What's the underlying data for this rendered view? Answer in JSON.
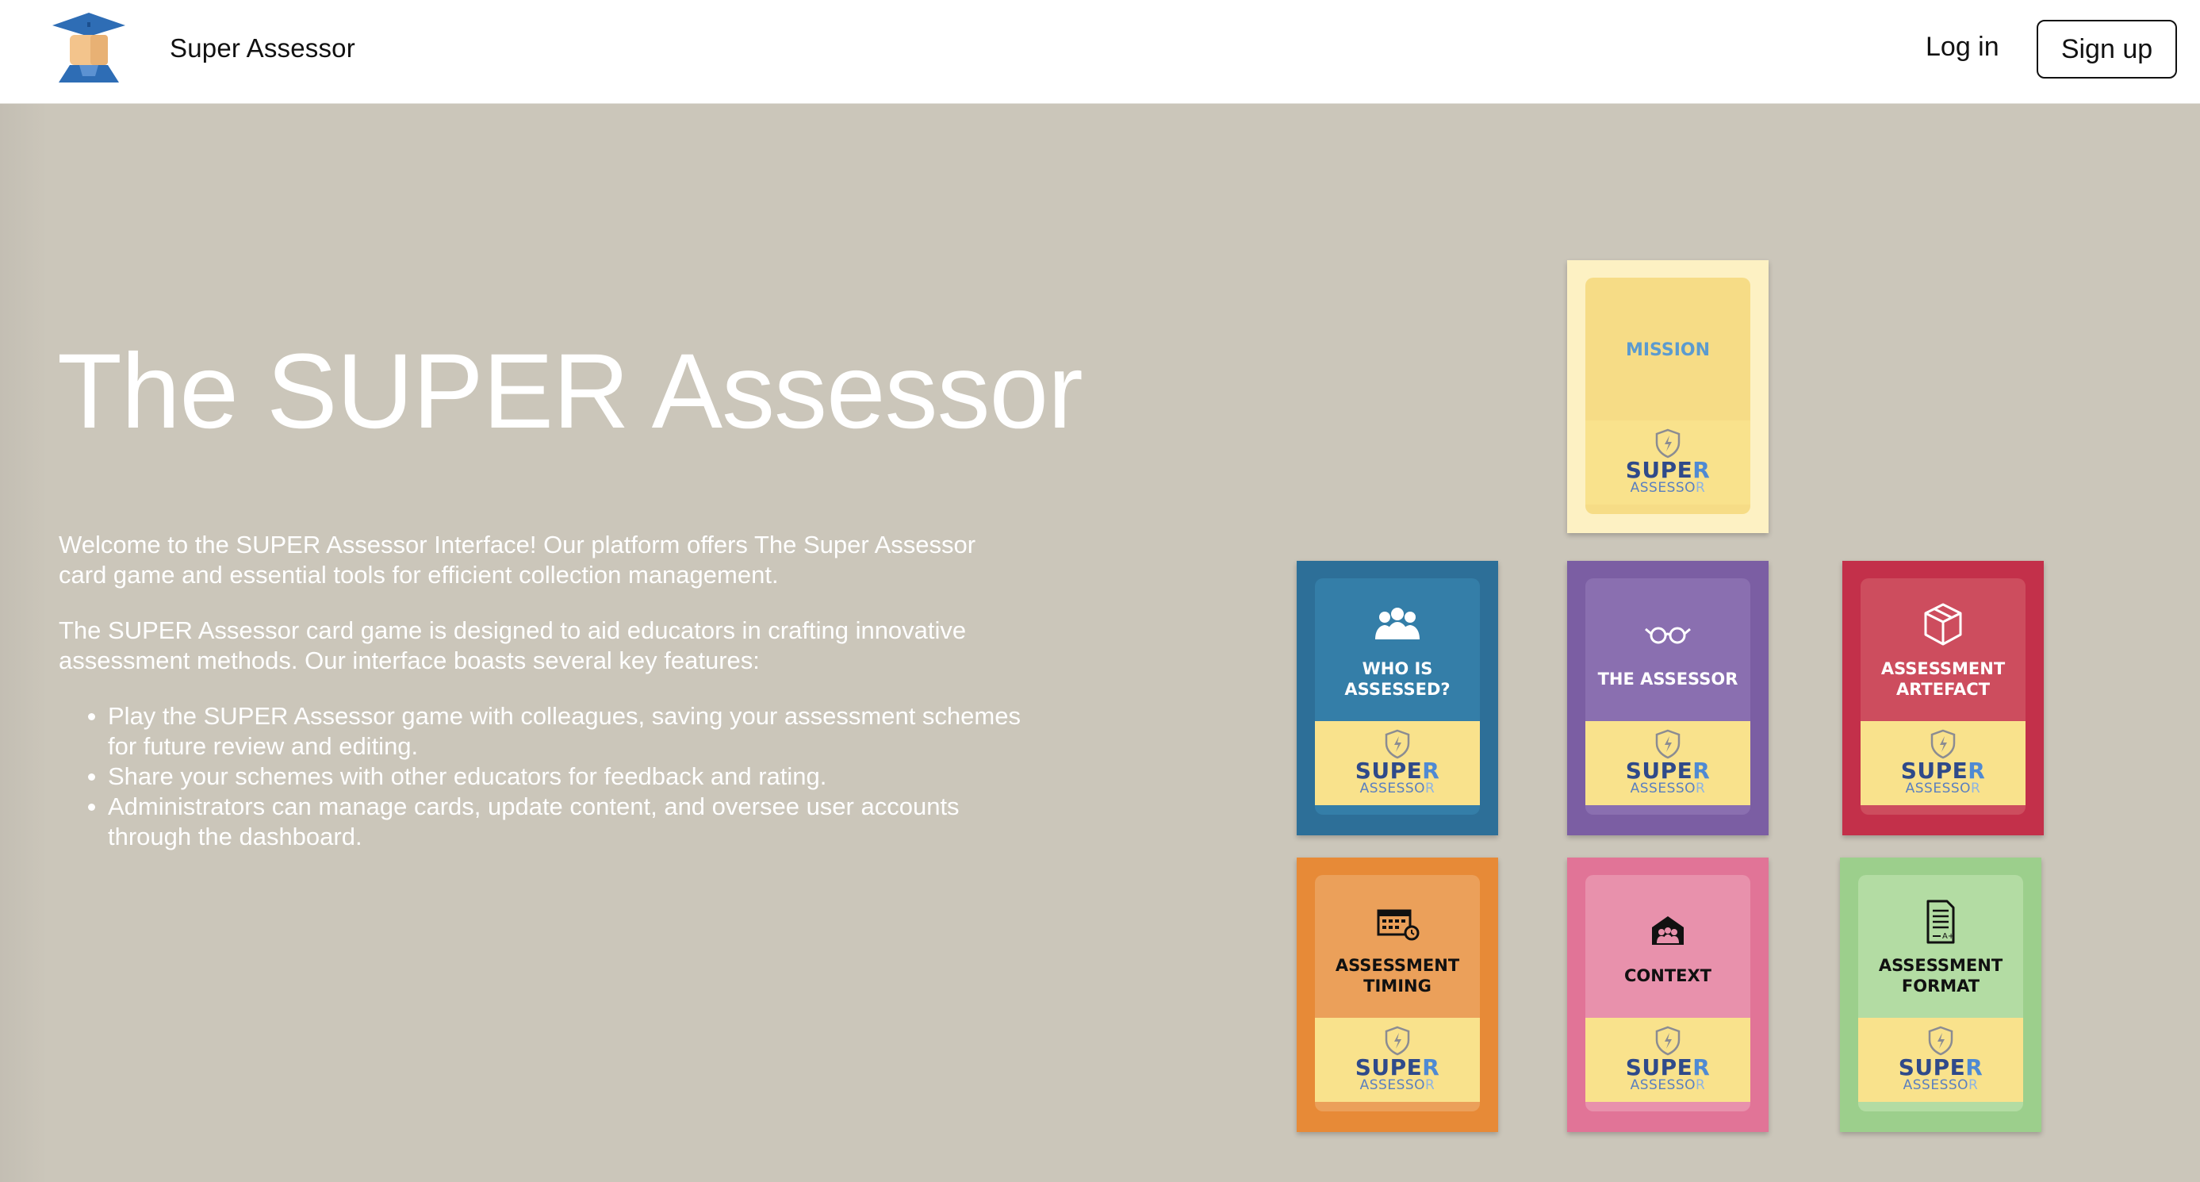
{
  "navbar": {
    "brand_name": "Super Assessor",
    "login_label": "Log in",
    "signup_label": "Sign up"
  },
  "hero": {
    "title": "The SUPER Assessor",
    "intro_1": "Welcome to the SUPER Assessor Interface! Our platform offers The Super Assessor card game and essential tools for efficient collection management.",
    "intro_2": "The SUPER Assessor card game is designed to aid educators in crafting innovative assessment methods. Our interface boasts several key features:",
    "features": [
      "Play the SUPER Assessor game with colleagues, saving your assessment schemes for future review and editing.",
      "Share your schemes with other educators for feedback and rating.",
      "Administrators can manage cards, update content, and oversee user accounts through the dashboard."
    ]
  },
  "cards": {
    "super_word": "SUPE",
    "super_word_end": "R",
    "assessor_word": "ASSESSO",
    "assessor_word_end": "R",
    "mission": {
      "title": "MISSION",
      "color": "#fdf1c3",
      "inner": "#f6dc86",
      "text": "#5b9bd0",
      "icon": ""
    },
    "who": {
      "title": "WHO IS ASSESSED?",
      "color": "#2d6f98",
      "inner": "#347ea8",
      "text": "#ffffff",
      "icon": "people-icon"
    },
    "assessor": {
      "title": "THE ASSESSOR",
      "color": "#7b5ea3",
      "inner": "#8a6fb0",
      "text": "#ffffff",
      "icon": "glasses-icon"
    },
    "artefact": {
      "title": "ASSESSMENT ARTEFACT",
      "color": "#c3304a",
      "inner": "#cd4d5e",
      "text": "#ffffff",
      "icon": "box-icon"
    },
    "timing": {
      "title": "ASSESSMENT TIMING",
      "color": "#e78a37",
      "inner": "#eba05a",
      "text": "#111111",
      "icon": "calendar-icon"
    },
    "context": {
      "title": "CONTEXT",
      "color": "#e17497",
      "inner": "#e891ac",
      "text": "#111111",
      "icon": "classroom-icon"
    },
    "format": {
      "title": "ASSESSMENT FORMAT",
      "color": "#9ccf8c",
      "inner": "#b3dca3",
      "text": "#111111",
      "icon": "document-icon"
    }
  }
}
